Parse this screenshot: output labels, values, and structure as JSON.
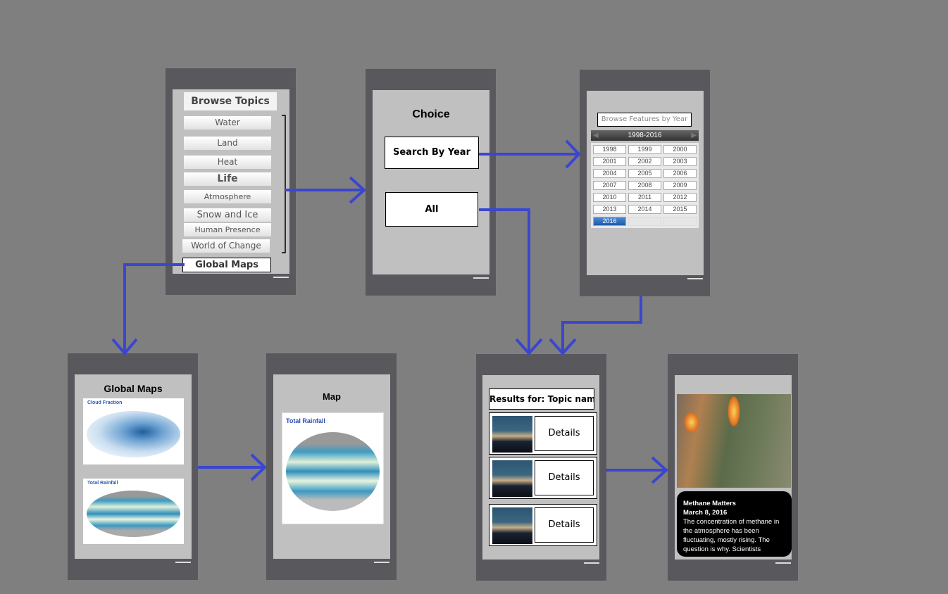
{
  "browse": {
    "title": "Browse Topics",
    "topics": [
      "Water",
      "Land",
      "Heat",
      "Life",
      "Atmosphere",
      "Snow and Ice",
      "Human Presence",
      "World of Change"
    ],
    "global_maps": "Global Maps"
  },
  "choice": {
    "title": "Choice",
    "search_by_year": "Search By Year",
    "all": "All"
  },
  "features": {
    "title": "Browse Features by Year",
    "range": "1998-2016",
    "years": [
      "1998",
      "1999",
      "2000",
      "2001",
      "2002",
      "2003",
      "2004",
      "2005",
      "2006",
      "2007",
      "2008",
      "2009",
      "2010",
      "2011",
      "2012",
      "2013",
      "2014",
      "2015",
      "2016"
    ],
    "selected": "2016"
  },
  "global_maps": {
    "title": "Global Maps",
    "maps": [
      "Cloud Fraction",
      "Total Rainfall"
    ]
  },
  "map": {
    "title": "Map",
    "map_label": "Total Rainfall"
  },
  "results": {
    "title": "Results for: Topic name",
    "details": [
      "Details",
      "Details",
      "Details"
    ]
  },
  "detail": {
    "headline": "Methane Matters",
    "date": "March 8, 2016",
    "body": "The concentration of methane in the atmosphere has been fluctuating, mostly rising. The question is why. Scientists"
  },
  "colors": {
    "arrow": "#3a46d0",
    "background": "#7f7f7f",
    "frame": "#59585d",
    "screen": "#c0c0c0"
  }
}
